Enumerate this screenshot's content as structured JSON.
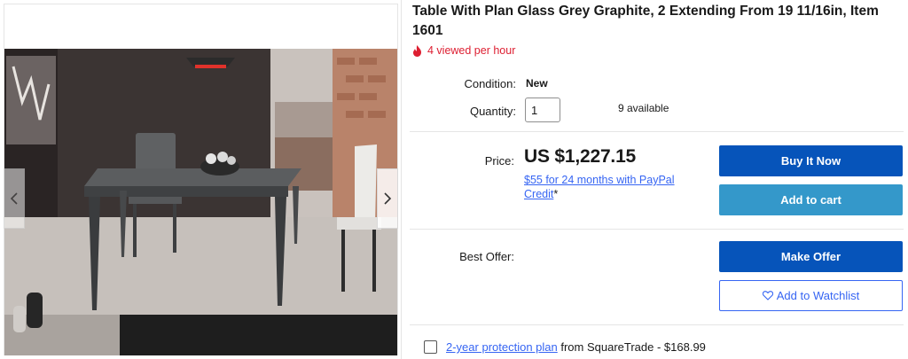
{
  "gallery": {
    "prev_icon": "chevron-left-icon",
    "next_icon": "chevron-right-icon"
  },
  "listing": {
    "title": "Table With Plan Glass Grey Graphite, 2 Extending From 19 11/16in, Item 1601",
    "viewed_icon": "flame-icon",
    "viewed_text": "4 viewed per hour"
  },
  "condition": {
    "label": "Condition:",
    "value": "New"
  },
  "quantity": {
    "label": "Quantity:",
    "value": "1",
    "available": "9 available"
  },
  "price": {
    "label": "Price:",
    "value": "US $1,227.15",
    "credit_link": "$55 for 24 months with PayPal Credit",
    "credit_mark": "*"
  },
  "buttons": {
    "buy_now": "Buy It Now",
    "add_to_cart": "Add to cart",
    "make_offer": "Make Offer",
    "watchlist": "Add to Watchlist",
    "watchlist_icon": "heart-icon"
  },
  "best_offer": {
    "label": "Best Offer:"
  },
  "protection": {
    "link": "2-year protection plan",
    "text": " from SquareTrade - $168.99"
  },
  "colors": {
    "primary_button": "#0654ba",
    "cart_button": "#3498ca",
    "link": "#3665f3",
    "alert": "#dd1e31"
  }
}
